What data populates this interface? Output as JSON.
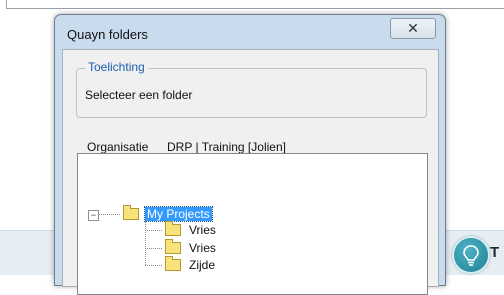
{
  "dialog": {
    "title": "Quayn folders",
    "close_glyph": "✕"
  },
  "groupbox": {
    "legend": "Toelichting",
    "text": "Selecteer een folder"
  },
  "organisation": {
    "label": "Organisatie",
    "value": "DRP | Training [Jolien]"
  },
  "tree": {
    "root": {
      "label": "My Projects",
      "expander": "−",
      "selected": true
    },
    "children": [
      {
        "label": "Vries"
      },
      {
        "label": "Vries"
      },
      {
        "label": "Zijde"
      }
    ]
  },
  "background": {
    "help_letter": "T"
  },
  "colors": {
    "selection": "#3399ff",
    "legend": "#1c5fb0",
    "dialog_frame": "#c9dcee"
  }
}
